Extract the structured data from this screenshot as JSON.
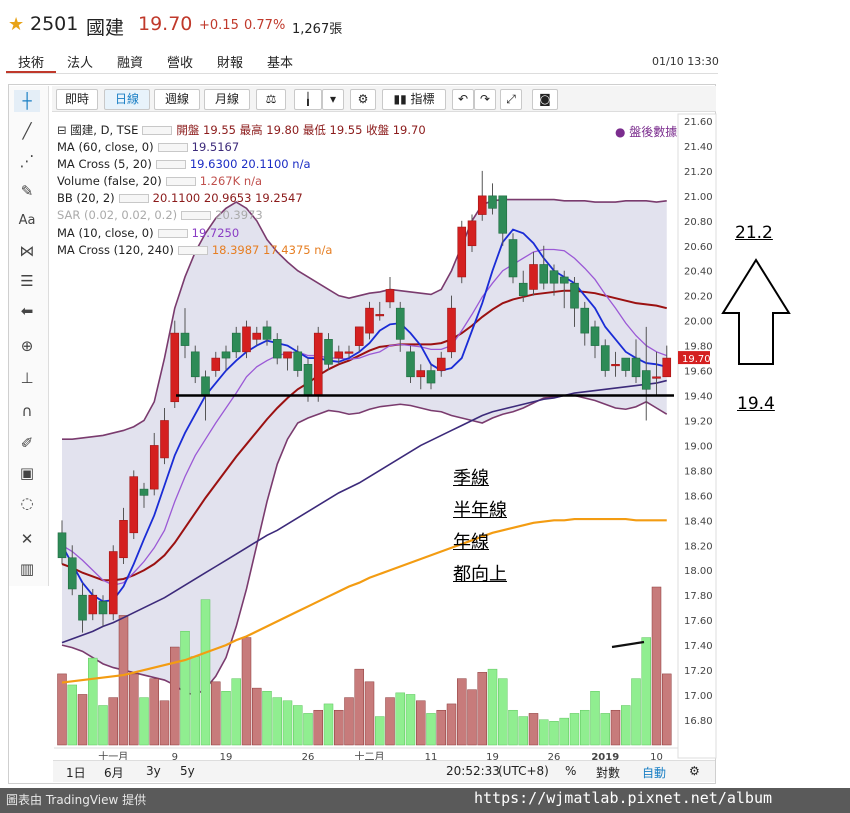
{
  "header": {
    "code": "2501",
    "name": "國建",
    "price": "19.70",
    "change": "+0.15",
    "change_pct": "0.77%",
    "volume": "1,267張",
    "accent": "#c0392b"
  },
  "tabs": [
    {
      "label": "技術"
    },
    {
      "label": "法人"
    },
    {
      "label": "融資"
    },
    {
      "label": "營收"
    },
    {
      "label": "財報"
    },
    {
      "label": "基本"
    }
  ],
  "datetime": "01/10 13:30",
  "toolbar": {
    "intraday": "即時",
    "daily": "日線",
    "weekly": "週線",
    "monthly": "月線",
    "indicators": "指標"
  },
  "legend": [
    {
      "label": "國建, D, TSE",
      "text": "開盤 19.55 最高 19.80 最低 19.55 收盤 19.70"
    },
    {
      "label": "MA (60, close, 0)",
      "text": "19.5167"
    },
    {
      "label": "MA Cross (5, 20)",
      "text": "19.6300 20.1100 n/a"
    },
    {
      "label": "Volume (false, 20)",
      "text": "1.267K n/a"
    },
    {
      "label": "BB (20, 2)",
      "text": "20.1100 20.9653 19.2547"
    },
    {
      "label": "SAR (0.02, 0.02, 0.2)",
      "text": "20.3973"
    },
    {
      "label": "MA (10, close, 0)",
      "text": "19.7250"
    },
    {
      "label": "MA Cross (120, 240)",
      "text": "18.3987 17.4375 n/a"
    }
  ],
  "after_market": "● 盤後數據",
  "bottom_bar": {
    "r1": "1日",
    "r2": "6月",
    "r3": "3y",
    "r4": "5y",
    "time": "20:52:33",
    "tz": "(UTC+8)",
    "pct": "%",
    "log": "對數",
    "auto": "自動"
  },
  "credit_left": "圖表由 TradingView 提供",
  "credit_right": "https://wjmatlab.pixnet.net/album",
  "annotations": {
    "high": "21.2",
    "low": "19.4",
    "note_lines": [
      "季線",
      "半年線",
      "年線",
      "都向上"
    ]
  },
  "chart_data": {
    "type": "candlestick",
    "y_ticks": [
      "21.60",
      "21.40",
      "21.20",
      "21.00",
      "20.80",
      "20.60",
      "20.40",
      "20.20",
      "20.00",
      "19.80",
      "19.60",
      "19.40",
      "19.20",
      "19.00",
      "18.80",
      "18.60",
      "18.40",
      "18.20",
      "18.00",
      "17.80",
      "17.60",
      "17.40",
      "17.20",
      "17.00",
      "16.80"
    ],
    "ylim": [
      16.68,
      21.68
    ],
    "last_price_label": "19.70",
    "x_labels": [
      {
        "i": 5,
        "label": "十一月"
      },
      {
        "i": 11,
        "label": "9"
      },
      {
        "i": 16,
        "label": "19"
      },
      {
        "i": 24,
        "label": "26"
      },
      {
        "i": 30,
        "label": "十二月"
      },
      {
        "i": 36,
        "label": "11"
      },
      {
        "i": 42,
        "label": "19"
      },
      {
        "i": 48,
        "label": "26"
      },
      {
        "i": 53,
        "label": "2019"
      },
      {
        "i": 58,
        "label": "10"
      }
    ],
    "candles": [
      [
        18.3,
        18.1,
        18.4,
        18.05
      ],
      [
        18.1,
        17.85,
        18.2,
        17.8
      ],
      [
        17.8,
        17.6,
        17.9,
        17.5
      ],
      [
        17.65,
        17.8,
        17.85,
        17.6
      ],
      [
        17.75,
        17.65,
        17.8,
        17.55
      ],
      [
        17.65,
        18.15,
        18.2,
        17.6
      ],
      [
        18.1,
        18.4,
        18.5,
        18.05
      ],
      [
        18.3,
        18.75,
        18.8,
        18.25
      ],
      [
        18.65,
        18.6,
        18.7,
        18.5
      ],
      [
        18.65,
        19.0,
        19.1,
        18.6
      ],
      [
        18.9,
        19.2,
        19.3,
        18.85
      ],
      [
        19.35,
        19.9,
        20.0,
        19.3
      ],
      [
        19.9,
        19.8,
        20.1,
        19.7
      ],
      [
        19.75,
        19.55,
        19.8,
        19.5
      ],
      [
        19.55,
        19.4,
        19.6,
        19.2
      ],
      [
        19.6,
        19.7,
        19.75,
        19.55
      ],
      [
        19.75,
        19.7,
        19.8,
        19.6
      ],
      [
        19.9,
        19.75,
        19.95,
        19.7
      ],
      [
        19.75,
        19.95,
        20.0,
        19.7
      ],
      [
        19.85,
        19.9,
        19.95,
        19.8
      ],
      [
        19.95,
        19.85,
        20.0,
        19.8
      ],
      [
        19.85,
        19.7,
        19.9,
        19.65
      ],
      [
        19.7,
        19.75,
        19.75,
        19.6
      ],
      [
        19.75,
        19.6,
        19.8,
        19.55
      ],
      [
        19.65,
        19.4,
        19.7,
        19.35
      ],
      [
        19.4,
        19.9,
        19.95,
        19.35
      ],
      [
        19.85,
        19.65,
        19.9,
        19.6
      ],
      [
        19.7,
        19.75,
        19.8,
        19.65
      ],
      [
        19.75,
        19.75,
        19.8,
        19.7
      ],
      [
        19.8,
        19.95,
        19.95,
        19.75
      ],
      [
        19.9,
        20.1,
        20.15,
        19.85
      ],
      [
        20.05,
        20.05,
        20.15,
        20.0
      ],
      [
        20.15,
        20.25,
        20.35,
        20.1
      ],
      [
        20.1,
        19.85,
        20.15,
        19.75
      ],
      [
        19.75,
        19.55,
        19.8,
        19.5
      ],
      [
        19.55,
        19.6,
        19.65,
        19.45
      ],
      [
        19.6,
        19.5,
        19.65,
        19.45
      ],
      [
        19.6,
        19.7,
        19.75,
        19.55
      ],
      [
        19.75,
        20.1,
        20.2,
        19.7
      ],
      [
        20.35,
        20.75,
        20.8,
        20.3
      ],
      [
        20.6,
        20.8,
        20.85,
        20.55
      ],
      [
        20.85,
        21.0,
        21.2,
        20.8
      ],
      [
        21.0,
        20.9,
        21.1,
        20.85
      ],
      [
        21.0,
        20.7,
        21.0,
        20.6
      ],
      [
        20.65,
        20.35,
        20.7,
        20.3
      ],
      [
        20.3,
        20.2,
        20.4,
        20.15
      ],
      [
        20.25,
        20.45,
        20.55,
        20.2
      ],
      [
        20.45,
        20.3,
        20.6,
        20.25
      ],
      [
        20.4,
        20.3,
        20.45,
        20.2
      ],
      [
        20.35,
        20.3,
        20.4,
        20.1
      ],
      [
        20.3,
        20.1,
        20.35,
        19.95
      ],
      [
        20.1,
        19.9,
        20.15,
        19.8
      ],
      [
        19.95,
        19.8,
        20.0,
        19.7
      ],
      [
        19.8,
        19.6,
        19.85,
        19.55
      ],
      [
        19.65,
        19.65,
        19.75,
        19.55
      ],
      [
        19.7,
        19.6,
        19.7,
        19.55
      ],
      [
        19.7,
        19.55,
        19.85,
        19.5
      ],
      [
        19.6,
        19.45,
        19.95,
        19.2
      ],
      [
        19.55,
        19.55,
        19.75,
        19.4
      ],
      [
        19.55,
        19.7,
        19.8,
        19.55
      ]
    ],
    "ma60": [
      17.42,
      17.45,
      17.48,
      17.51,
      17.55,
      17.58,
      17.62,
      17.66,
      17.7,
      17.74,
      17.78,
      17.83,
      17.88,
      17.93,
      17.98,
      18.03,
      18.08,
      18.13,
      18.18,
      18.23,
      18.28,
      18.32,
      18.37,
      18.42,
      18.47,
      18.52,
      18.57,
      18.62,
      18.66,
      18.7,
      18.75,
      18.8,
      18.85,
      18.9,
      18.95,
      19.0,
      19.04,
      19.08,
      19.12,
      19.16,
      19.2,
      19.24,
      19.27,
      19.29,
      19.31,
      19.33,
      19.35,
      19.37,
      19.38,
      19.4,
      19.42,
      19.43,
      19.44,
      19.45,
      19.46,
      19.47,
      19.48,
      19.49,
      19.5,
      19.52
    ],
    "ma20": [
      18.05,
      18.02,
      17.98,
      17.95,
      17.92,
      17.92,
      17.93,
      17.96,
      18.0,
      18.05,
      18.12,
      18.22,
      18.34,
      18.46,
      18.58,
      18.69,
      18.8,
      18.91,
      19.01,
      19.11,
      19.21,
      19.3,
      19.38,
      19.45,
      19.5,
      19.56,
      19.61,
      19.65,
      19.68,
      19.72,
      19.76,
      19.79,
      19.8,
      19.81,
      19.81,
      19.81,
      19.81,
      19.82,
      19.85,
      19.9,
      19.96,
      20.03,
      20.09,
      20.14,
      20.17,
      20.19,
      20.21,
      20.22,
      20.23,
      20.24,
      20.24,
      20.23,
      20.22,
      20.2,
      20.18,
      20.16,
      20.14,
      20.13,
      20.12,
      20.1
    ],
    "ma10": [
      18.2,
      18.15,
      18.08,
      18.0,
      17.92,
      17.88,
      17.9,
      17.98,
      18.07,
      18.18,
      18.32,
      18.55,
      18.75,
      18.92,
      19.05,
      19.18,
      19.3,
      19.42,
      19.55,
      19.63,
      19.68,
      19.72,
      19.74,
      19.75,
      19.72,
      19.72,
      19.7,
      19.7,
      19.69,
      19.7,
      19.73,
      19.75,
      19.8,
      19.81,
      19.8,
      19.79,
      19.77,
      19.77,
      19.8,
      19.92,
      20.05,
      20.19,
      20.3,
      20.4,
      20.45,
      20.5,
      20.55,
      20.57,
      20.57,
      20.56,
      20.5,
      20.42,
      20.33,
      20.21,
      20.1,
      19.98,
      19.88,
      19.8,
      19.75,
      19.72
    ],
    "ma5": [
      18.2,
      18.05,
      17.9,
      17.8,
      17.75,
      17.76,
      17.87,
      18.05,
      18.25,
      18.44,
      18.68,
      18.92,
      19.1,
      19.25,
      19.4,
      19.5,
      19.6,
      19.68,
      19.75,
      19.8,
      19.84,
      19.82,
      19.8,
      19.75,
      19.7,
      19.7,
      19.68,
      19.67,
      19.7,
      19.75,
      19.82,
      19.92,
      19.97,
      19.98,
      19.9,
      19.8,
      19.65,
      19.6,
      19.62,
      19.7,
      19.92,
      20.14,
      20.4,
      20.63,
      20.73,
      20.7,
      20.62,
      20.5,
      20.4,
      20.35,
      20.3,
      20.2,
      20.1,
      19.95,
      19.85,
      19.75,
      19.7,
      19.66,
      19.65,
      19.63
    ],
    "bb_upper": [
      19.05,
      19.05,
      19.06,
      19.07,
      19.08,
      19.1,
      19.12,
      19.15,
      19.2,
      19.35,
      19.7,
      20.1,
      20.35,
      20.55,
      20.7,
      20.82,
      20.9,
      20.95,
      20.9,
      20.8,
      20.65,
      20.55,
      20.47,
      20.4,
      20.35,
      20.3,
      20.25,
      20.2,
      20.18,
      20.2,
      20.22,
      20.23,
      20.25,
      20.24,
      20.23,
      20.22,
      20.21,
      20.25,
      20.4,
      20.6,
      20.8,
      20.93,
      20.96,
      20.97,
      20.97,
      20.97,
      20.97,
      20.97,
      20.97,
      20.96,
      20.96,
      20.96,
      20.95,
      20.95,
      20.95,
      20.96,
      20.96,
      20.96,
      20.95,
      20.96
    ],
    "bb_lower": [
      17.4,
      17.38,
      17.35,
      17.3,
      17.25,
      17.22,
      17.2,
      17.18,
      17.16,
      17.14,
      17.12,
      17.08,
      17.02,
      17.0,
      17.05,
      17.15,
      17.3,
      17.55,
      17.85,
      18.2,
      18.55,
      18.85,
      19.05,
      19.18,
      19.22,
      19.25,
      19.28,
      19.27,
      19.25,
      19.26,
      19.29,
      19.31,
      19.32,
      19.33,
      19.32,
      19.3,
      19.28,
      19.27,
      19.24,
      19.22,
      19.2,
      19.18,
      19.22,
      19.25,
      19.27,
      19.3,
      19.34,
      19.38,
      19.39,
      19.4,
      19.4,
      19.38,
      19.36,
      19.33,
      19.3,
      19.29,
      19.31,
      19.35,
      19.3,
      19.25
    ],
    "ma120": [
      17.1,
      17.11,
      17.12,
      17.13,
      17.14,
      17.15,
      17.16,
      17.18,
      17.2,
      17.22,
      17.24,
      17.26,
      17.28,
      17.31,
      17.34,
      17.37,
      17.4,
      17.44,
      17.47,
      17.51,
      17.55,
      17.59,
      17.63,
      17.67,
      17.71,
      17.75,
      17.79,
      17.83,
      17.87,
      17.9,
      17.94,
      17.97,
      18.0,
      18.03,
      18.06,
      18.09,
      18.12,
      18.15,
      18.18,
      18.21,
      18.24,
      18.27,
      18.3,
      18.32,
      18.34,
      18.36,
      18.38,
      18.39,
      18.4,
      18.4,
      18.41,
      18.41,
      18.41,
      18.41,
      18.41,
      18.41,
      18.4,
      18.4,
      18.4,
      18.4
    ],
    "volume": [
      0.45,
      0.38,
      0.32,
      0.55,
      0.25,
      0.3,
      0.82,
      0.45,
      0.3,
      0.42,
      0.28,
      0.62,
      0.72,
      0.56,
      0.92,
      0.4,
      0.34,
      0.42,
      0.68,
      0.36,
      0.34,
      0.3,
      0.28,
      0.25,
      0.2,
      0.22,
      0.26,
      0.22,
      0.3,
      0.48,
      0.4,
      0.18,
      0.3,
      0.33,
      0.32,
      0.28,
      0.2,
      0.22,
      0.26,
      0.42,
      0.35,
      0.46,
      0.48,
      0.42,
      0.22,
      0.18,
      0.2,
      0.16,
      0.15,
      0.17,
      0.2,
      0.22,
      0.34,
      0.2,
      0.22,
      0.25,
      0.42,
      0.68,
      1.0,
      0.45
    ],
    "volume_up": [
      true,
      false,
      true,
      false,
      false,
      true,
      true,
      true,
      false,
      true,
      true,
      true,
      false,
      false,
      false,
      true,
      false,
      false,
      true,
      true,
      false,
      false,
      false,
      false,
      false,
      true,
      false,
      true,
      true,
      true,
      true,
      false,
      true,
      false,
      false,
      true,
      false,
      true,
      true,
      true,
      true,
      true,
      false,
      false,
      false,
      false,
      true,
      false,
      false,
      false,
      false,
      false,
      false,
      false,
      true,
      false,
      false,
      false,
      true,
      true
    ],
    "support_line": 19.4,
    "volume_trend": [
      17.6,
      17.63
    ]
  }
}
